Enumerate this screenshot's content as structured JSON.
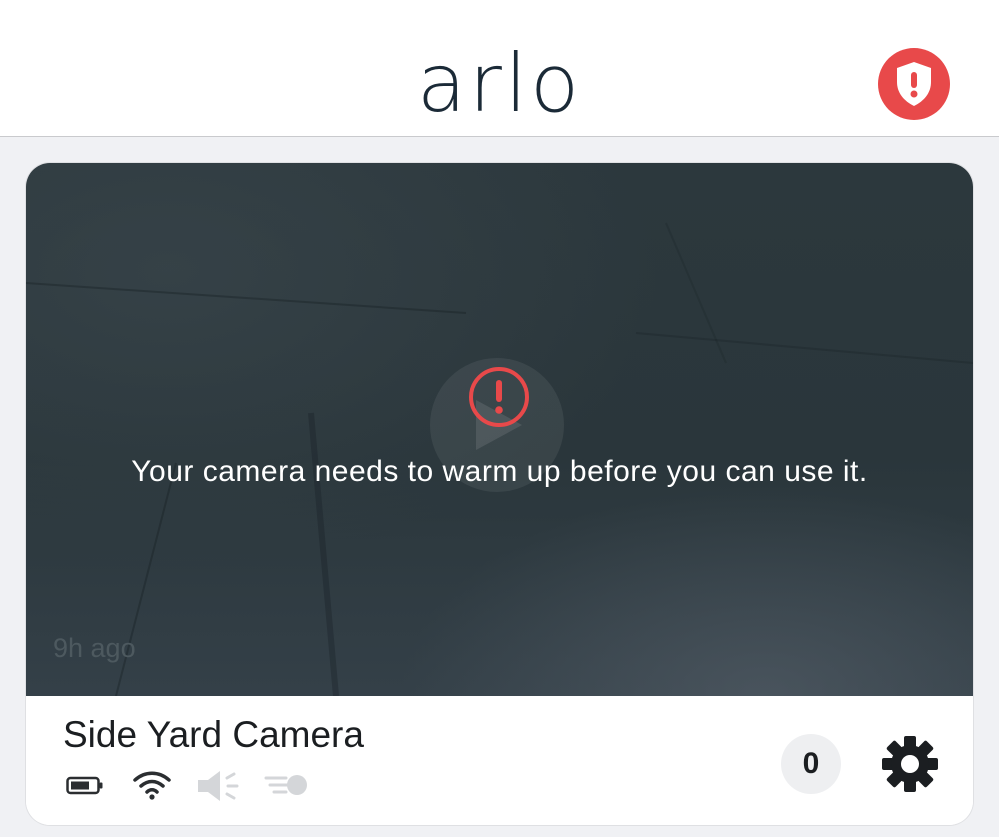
{
  "header": {
    "logo_text": "arlo",
    "alert_icon": "shield-exclamation-icon"
  },
  "camera_card": {
    "preview": {
      "message": "Your camera needs to warm up before you can use it.",
      "timestamp": "9h ago",
      "warning_icon": "exclamation-circle-icon",
      "play_icon": "play-icon"
    },
    "name": "Side Yard Camera",
    "status_icons": [
      "battery-icon",
      "wifi-icon",
      "speaker-muted-icon",
      "motion-sensor-icon"
    ],
    "event_count": "0",
    "settings_icon": "gear-icon"
  },
  "colors": {
    "brand_text": "#1b2a37",
    "alert_red": "#e8494a",
    "video_bg": "#2c383d",
    "page_bg": "#f0f1f4"
  }
}
